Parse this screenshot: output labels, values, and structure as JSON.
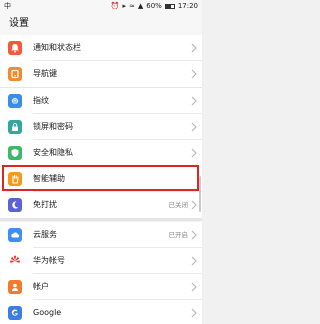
{
  "status_bar": {
    "signal_text": "中",
    "battery_percent": "60%",
    "battery_level": 0.6,
    "time": "17:20"
  },
  "header": {
    "title": "设置"
  },
  "settings": [
    {
      "label": "通知和状态栏",
      "icon": "bell-icon",
      "color": "#f15a3a",
      "value": ""
    },
    {
      "label": "导航键",
      "icon": "navigation-key-icon",
      "color": "#f18a2e",
      "value": ""
    },
    {
      "label": "指纹",
      "icon": "fingerprint-icon",
      "color": "#3a8ee6",
      "value": ""
    },
    {
      "label": "锁屏和密码",
      "icon": "lock-icon",
      "color": "#2fa8a0",
      "value": ""
    },
    {
      "label": "安全和隐私",
      "icon": "shield-icon",
      "color": "#3cb86b",
      "value": ""
    },
    {
      "label": "智能辅助",
      "icon": "hand-icon",
      "color": "#f39a1d",
      "value": ""
    },
    {
      "label": "免打扰",
      "icon": "moon-icon",
      "color": "#5a62d6",
      "value": "已关闭"
    },
    {
      "label": "云服务",
      "icon": "cloud-icon",
      "color": "#3f8ef0",
      "value": "已开启"
    },
    {
      "label": "华为帐号",
      "icon": "huawei-icon",
      "color": "#e5322d",
      "value": ""
    },
    {
      "label": "帐户",
      "icon": "account-icon",
      "color": "#f47a2c",
      "value": ""
    },
    {
      "label": "Google",
      "icon": "google-icon",
      "color": "#3b7fe0",
      "value": ""
    }
  ],
  "highlight": {
    "target_label": "智能辅助",
    "color": "#e02424"
  }
}
